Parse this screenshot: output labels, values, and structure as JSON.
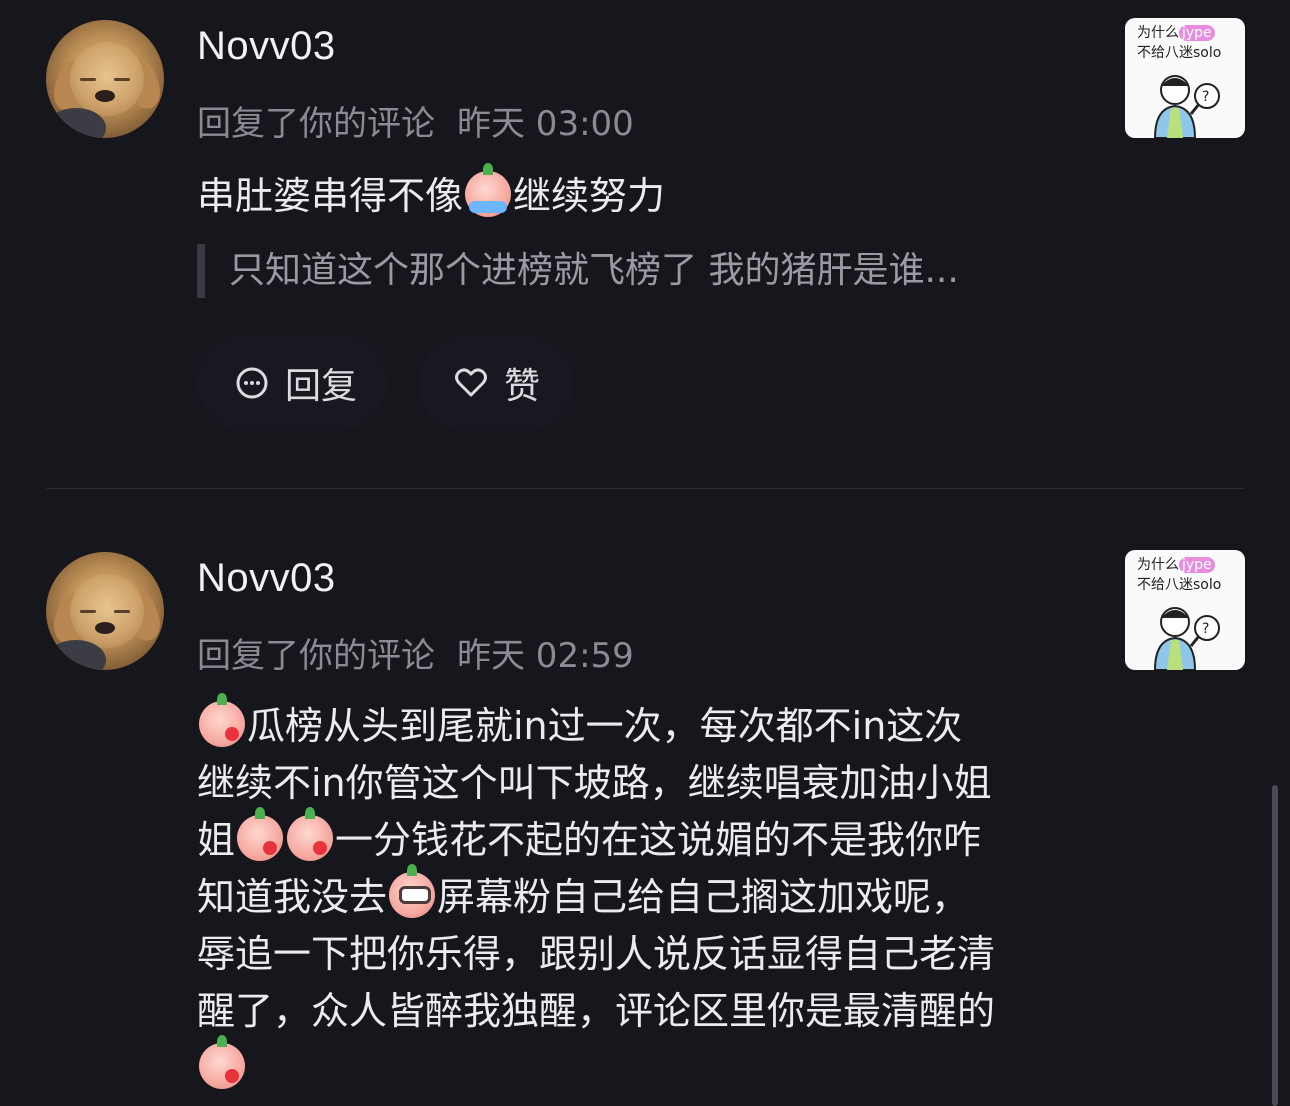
{
  "comments": [
    {
      "username": "Novv03",
      "action": "回复了你的评论",
      "time": "昨天 03:00",
      "text_part1": "串肚婆串得不像",
      "text_part2": "继续努力",
      "quote": "只知道这个那个进榜就飞榜了 我的猪肝是谁...",
      "reply_label": "回复",
      "like_label": "赞",
      "thumb_line1_a": "为什么",
      "thumb_line1_hl": "jype",
      "thumb_line2": "不给八迷solo"
    },
    {
      "username": "Novv03",
      "action": "回复了你的评论",
      "time": "昨天 02:59",
      "line1": "瓜榜从头到尾就in过一次，每次都不in这次",
      "line2": "继续不in你管这个叫下坡路，继续唱衰加油小姐",
      "line3a": "姐",
      "line3b": "一分钱花不起的在这说媚的不是我你咋",
      "line4a": "知道我没去",
      "line4b": "屏幕粉自己给自己搁这加戏呢，",
      "line5": "辱追一下把你乐得，跟别人说反话显得自己老清",
      "line6": "醒了，众人皆醉我独醒，评论区里你是最清醒的",
      "thumb_line1_a": "为什么",
      "thumb_line1_hl": "jype",
      "thumb_line2": "不给八迷solo"
    }
  ],
  "icons": {
    "avatar": "golden-retriever-puppy-avatar",
    "reply": "chat-bubble-icon",
    "like": "heart-outline-icon",
    "emoji_cry": "crying-peach-emoji",
    "emoji_kiss": "blowing-kiss-peach-emoji",
    "emoji_shock": "shocked-sweat-peach-emoji"
  },
  "colors": {
    "background": "#16161d",
    "text_primary": "#ececef",
    "text_secondary": "#8b8b93",
    "thumb_highlight": "#e88ce0"
  }
}
